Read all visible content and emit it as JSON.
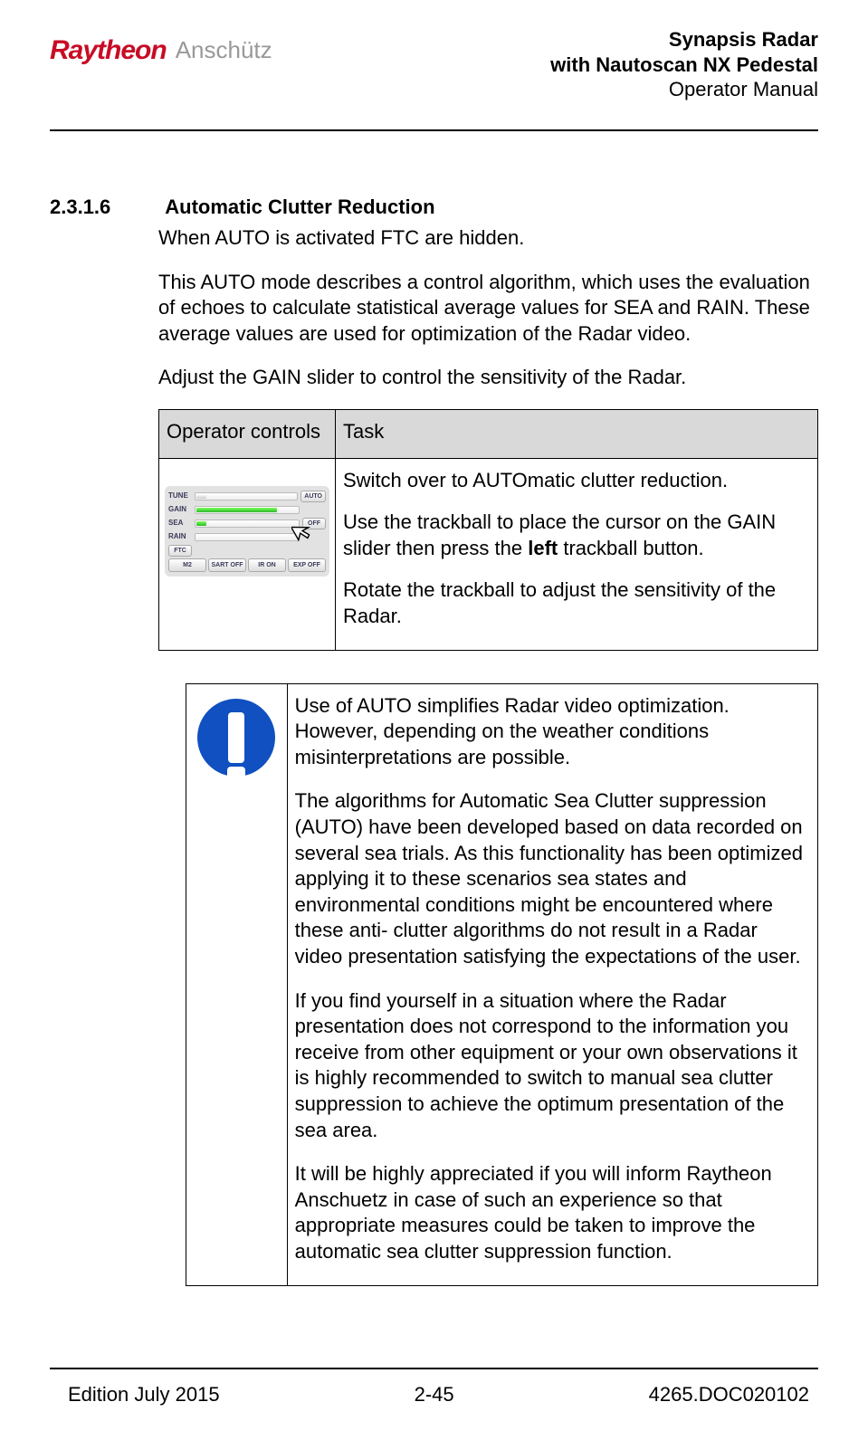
{
  "header": {
    "logo1": "Raytheon",
    "logo2": "Anschütz",
    "title1": "Synapsis Radar",
    "title2": "with Nautoscan NX Pedestal",
    "title3": "Operator Manual"
  },
  "section": {
    "number": "2.3.1.6",
    "title": "Automatic Clutter Reduction",
    "p1": "When AUTO is activated FTC are hidden.",
    "p2": "This AUTO mode describes a control algorithm, which uses the evaluation of echoes to calculate statistical average values for SEA and RAIN. These average values are used for optimization of the Radar video.",
    "p3": "Adjust the GAIN slider to control the sensitivity of the Radar."
  },
  "table1": {
    "h1": "Operator controls",
    "h2": "Task",
    "panel": {
      "rows": [
        "TUNE",
        "GAIN",
        "SEA",
        "RAIN",
        "FTC"
      ],
      "btn_auto": "AUTO",
      "btn_off": "OFF",
      "bottom": [
        "M2",
        "SART OFF",
        "IR ON",
        "EXP OFF"
      ]
    },
    "task": {
      "t1": "Switch over to AUTOmatic clutter reduction.",
      "t2a": "Use the trackball to place the cursor on the GAIN slider then press the ",
      "t2b": "left",
      "t2c": " trackball button.",
      "t3": "Rotate the trackball to adjust the sensitivity of the Radar."
    }
  },
  "note": {
    "n1": "Use of AUTO simplifies Radar video optimization. However, depending on the weather conditions misinterpretations are possible.",
    "n2": "The algorithms for Automatic Sea Clutter suppression (AUTO) have been developed based on data recorded on several sea trials. As this functionality has been optimized applying it to these scenarios sea states and environmental conditions might be encountered where these anti- clutter algorithms do not result in a Radar video presentation satisfying the expectations of the user.",
    "n3": "If you find yourself in a situation where the Radar presentation does not correspond to the information you receive from other equipment or your own observations it is highly recommended to switch to manual sea clutter suppression to achieve the optimum presentation of the sea area.",
    "n4": "It will be highly appreciated if you will inform Raytheon Anschuetz in case of such an experience so that appropriate measures could be taken to improve the automatic sea clutter suppression function."
  },
  "footer": {
    "left": "Edition July 2015",
    "center": "2-45",
    "right": "4265.DOC020102"
  }
}
